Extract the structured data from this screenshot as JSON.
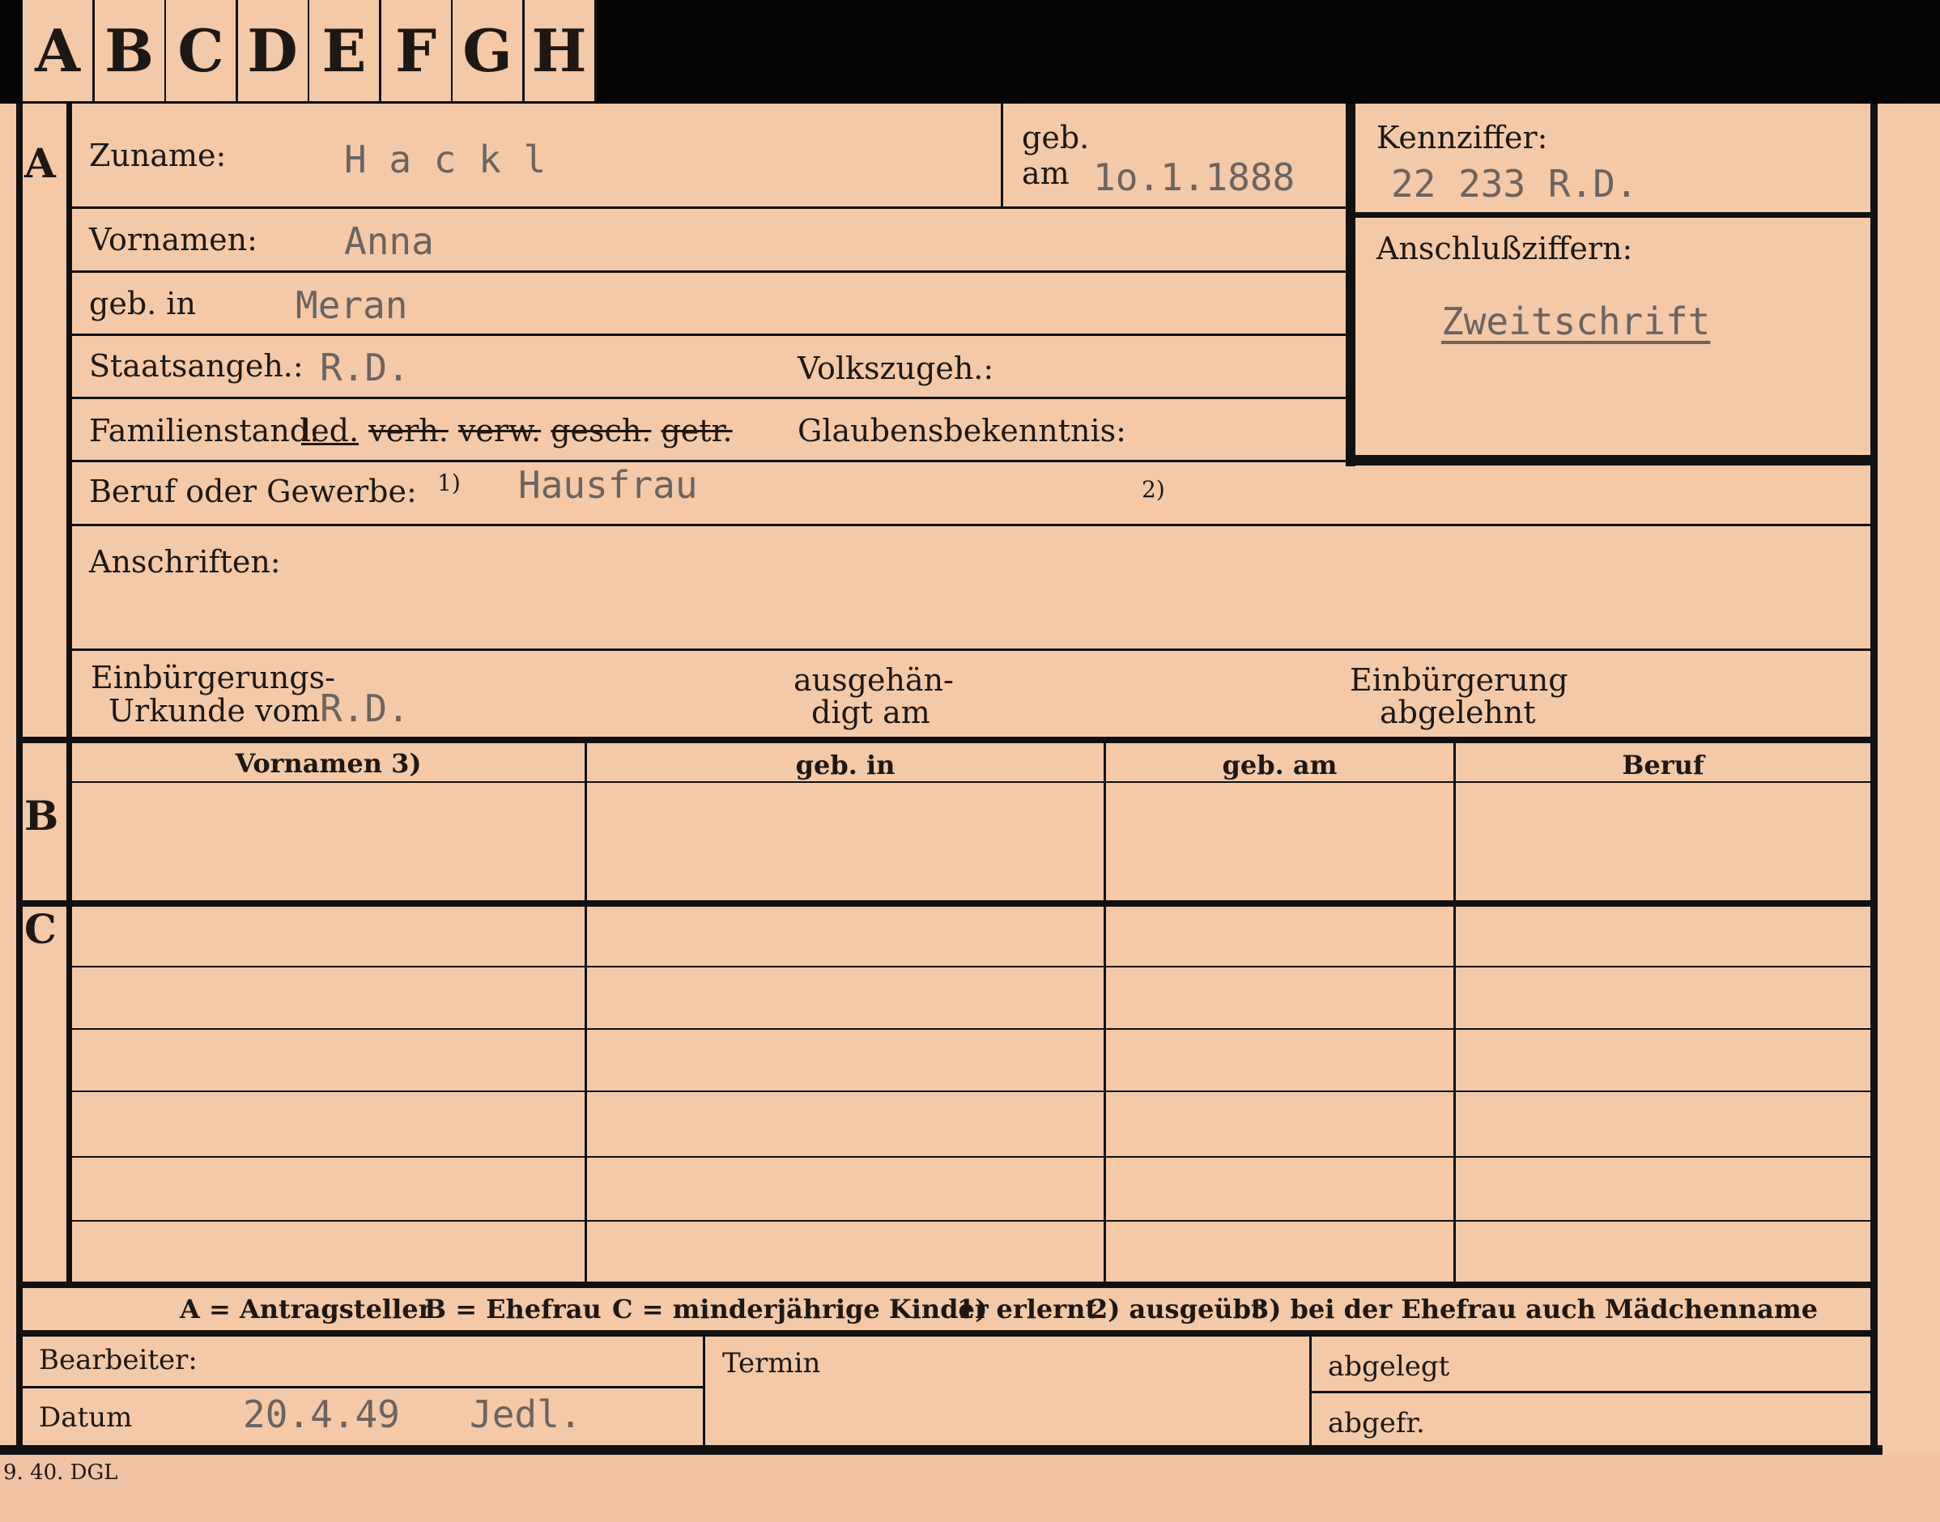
{
  "tabs": [
    "A",
    "B",
    "C",
    "D",
    "E",
    "F",
    "G",
    "H"
  ],
  "section_letters": {
    "a": "A",
    "b": "B",
    "c": "C"
  },
  "fields": {
    "zuname_label": "Zuname:",
    "zuname_value": "H a c k l",
    "geb_label": "geb.",
    "am_label": "am",
    "geb_am_value": "1o.1.1888",
    "kennziffer_label": "Kennziffer:",
    "kennziffer_value": "22 233 R.D.",
    "vornamen_label": "Vornamen:",
    "vornamen_value": "Anna",
    "anschlussziffern_label": "Anschlußziffern:",
    "anschlussziffern_value": "Zweitschrift",
    "geb_in_label": "geb. in",
    "geb_in_value": "Meran",
    "staatsangeh_label": "Staatsangeh.:",
    "staatsangeh_value": "R.D.",
    "volkszugeh_label": "Volkszugeh.:",
    "familienstand_label": "Familienstand:",
    "familienstand_options": [
      "led.",
      "verh.",
      "verw.",
      "gesch.",
      "getr."
    ],
    "glaubensbekenntnis_label": "Glaubensbekenntnis:",
    "beruf_label": "Beruf oder Gewerbe:",
    "beruf_mark1": "1)",
    "beruf_value": "Hausfrau",
    "beruf_mark2": "2)",
    "anschriften_label": "Anschriften:",
    "einbuergerung_label_1": "Einbürgerungs-",
    "einbuergerung_label_2": "Urkunde vom",
    "einbuergerung_value": "R.D.",
    "ausgehaendigt_1": "ausgehän-",
    "ausgehaendigt_2": "digt am",
    "abgelehnt_1": "Einbürgerung",
    "abgelehnt_2": "abgelehnt"
  },
  "table_headers": [
    "Vornamen 3)",
    "geb. in",
    "geb. am",
    "Beruf"
  ],
  "legend": {
    "a": "A = Antragsteller",
    "b": "B = Ehefrau",
    "c": "C = minderjährige Kinder",
    "n1": "1) erlernt",
    "n2": "2) ausgeübt",
    "n3": "3) bei der Ehefrau auch Mädchenname"
  },
  "footer": {
    "bearbeiter_label": "Bearbeiter:",
    "datum_label": "Datum",
    "datum_value": "20.4.49",
    "signature": "Jedl.",
    "termin_label": "Termin",
    "abgelegt_label": "abgelegt",
    "abgefr_label": "abgefr.",
    "printer_mark": "9. 40. DGL"
  }
}
